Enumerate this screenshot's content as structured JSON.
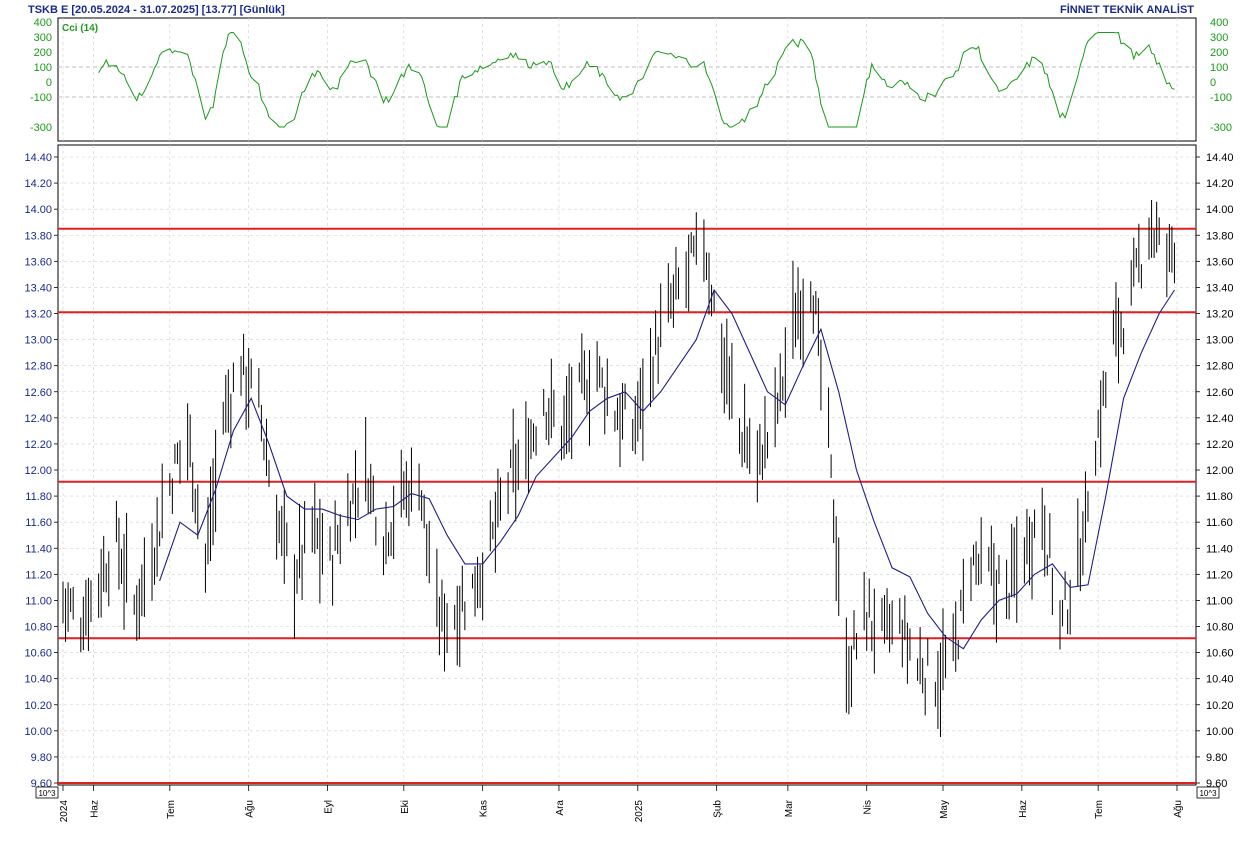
{
  "header": {
    "title": "TSKB  E  [20.05.2024 - 31.07.2025]  [13.77]  [Günlük]",
    "brand": "FİNNET TEKNİK ANALİST"
  },
  "indicator": {
    "label": "Cci (14)",
    "ticks": [
      "400",
      "300",
      "200",
      "100",
      "0",
      "-100",
      "-300"
    ],
    "tick_values": [
      400,
      300,
      200,
      100,
      0,
      -100,
      -300
    ],
    "ylim": [
      -380,
      400
    ],
    "color": "#1a9a1a"
  },
  "price_axis": {
    "ticks": [
      "14.40",
      "14.20",
      "14.00",
      "13.80",
      "13.60",
      "13.40",
      "13.20",
      "13.00",
      "12.80",
      "12.60",
      "12.40",
      "12.20",
      "12.00",
      "11.80",
      "11.60",
      "11.40",
      "11.20",
      "11.00",
      "10.80",
      "10.60",
      "10.40",
      "10.20",
      "10.00",
      "9.80",
      "9.60"
    ],
    "unit_label": "10^3",
    "ylim": [
      9.6,
      14.4
    ]
  },
  "time_axis": {
    "labels": [
      "2024",
      "Haz",
      "Tem",
      "Ağu",
      "Eyl",
      "Eki",
      "Kas",
      "Ara",
      "2025",
      "Şub",
      "Mar",
      "Nis",
      "May",
      "Haz",
      "Tem",
      "Ağu"
    ]
  },
  "levels": {
    "values": [
      13.85,
      13.21,
      11.91,
      10.71,
      9.6
    ],
    "color": "#e02020"
  },
  "chart_data": {
    "type": "bar",
    "title": "TSKB  E  [20.05.2024 - 31.07.2025]  [13.77]  [Günlük]",
    "xlabel": "",
    "ylabel": "",
    "ylim": [
      9.6,
      14.4
    ],
    "x_range": [
      "2024-05-20",
      "2025-07-31"
    ],
    "month_ticks": [
      {
        "label": "2024",
        "date": "2024-05-20"
      },
      {
        "label": "Haz",
        "date": "2024-06-01"
      },
      {
        "label": "Tem",
        "date": "2024-07-01"
      },
      {
        "label": "Ağu",
        "date": "2024-08-01"
      },
      {
        "label": "Eyl",
        "date": "2024-09-01"
      },
      {
        "label": "Eki",
        "date": "2024-10-01"
      },
      {
        "label": "Kas",
        "date": "2024-11-01"
      },
      {
        "label": "Ara",
        "date": "2024-12-01"
      },
      {
        "label": "2025",
        "date": "2025-01-01"
      },
      {
        "label": "Şub",
        "date": "2025-02-01"
      },
      {
        "label": "Mar",
        "date": "2025-03-01"
      },
      {
        "label": "Nis",
        "date": "2025-04-01"
      },
      {
        "label": "May",
        "date": "2025-05-01"
      },
      {
        "label": "Haz",
        "date": "2025-06-01"
      },
      {
        "label": "Tem",
        "date": "2025-07-01"
      },
      {
        "label": "Ağu",
        "date": "2025-08-01"
      }
    ],
    "last_close": 13.77,
    "series": [
      {
        "kind": "close",
        "points": [
          [
            "2024-05-20",
            11.0
          ],
          [
            "2024-05-27",
            10.85
          ],
          [
            "2024-06-03",
            11.15
          ],
          [
            "2024-06-10",
            11.45
          ],
          [
            "2024-06-17",
            10.95
          ],
          [
            "2024-06-24",
            11.35
          ],
          [
            "2024-07-01",
            11.9
          ],
          [
            "2024-07-08",
            12.3
          ],
          [
            "2024-07-15",
            11.3
          ],
          [
            "2024-07-22",
            12.4
          ],
          [
            "2024-07-29",
            12.8
          ],
          [
            "2024-08-05",
            12.5
          ],
          [
            "2024-08-12",
            11.6
          ],
          [
            "2024-08-19",
            11.2
          ],
          [
            "2024-08-26",
            11.55
          ],
          [
            "2024-09-02",
            11.3
          ],
          [
            "2024-09-09",
            11.7
          ],
          [
            "2024-09-16",
            12.0
          ],
          [
            "2024-09-23",
            11.5
          ],
          [
            "2024-09-30",
            11.8
          ],
          [
            "2024-10-07",
            11.95
          ],
          [
            "2024-10-14",
            10.85
          ],
          [
            "2024-10-21",
            10.9
          ],
          [
            "2024-10-28",
            11.1
          ],
          [
            "2024-11-04",
            11.4
          ],
          [
            "2024-11-11",
            11.9
          ],
          [
            "2024-11-18",
            12.1
          ],
          [
            "2024-11-25",
            12.55
          ],
          [
            "2024-12-02",
            12.3
          ],
          [
            "2024-12-09",
            12.6
          ],
          [
            "2024-12-16",
            12.75
          ],
          [
            "2024-12-23",
            12.45
          ],
          [
            "2024-12-30",
            12.3
          ],
          [
            "2025-01-06",
            12.8
          ],
          [
            "2025-01-13",
            13.2
          ],
          [
            "2025-01-20",
            13.5
          ],
          [
            "2025-01-27",
            13.75
          ],
          [
            "2025-02-03",
            12.9
          ],
          [
            "2025-02-10",
            12.3
          ],
          [
            "2025-02-17",
            12.05
          ],
          [
            "2025-02-24",
            12.4
          ],
          [
            "2025-03-03",
            13.1
          ],
          [
            "2025-03-10",
            13.5
          ],
          [
            "2025-03-17",
            12.2
          ],
          [
            "2025-03-24",
            10.4
          ],
          [
            "2025-03-31",
            10.9
          ],
          [
            "2025-04-07",
            10.75
          ],
          [
            "2025-04-14",
            10.8
          ],
          [
            "2025-04-21",
            10.5
          ],
          [
            "2025-04-28",
            10.4
          ],
          [
            "2025-05-05",
            10.55
          ],
          [
            "2025-05-12",
            11.3
          ],
          [
            "2025-05-19",
            11.2
          ],
          [
            "2025-05-26",
            11.05
          ],
          [
            "2025-06-02",
            11.4
          ],
          [
            "2025-06-09",
            11.7
          ],
          [
            "2025-06-16",
            10.8
          ],
          [
            "2025-06-23",
            11.25
          ],
          [
            "2025-06-30",
            12.2
          ],
          [
            "2025-07-07",
            13.0
          ],
          [
            "2025-07-14",
            13.3
          ],
          [
            "2025-07-21",
            13.9
          ],
          [
            "2025-07-28",
            13.6
          ],
          [
            "2025-07-31",
            13.77
          ]
        ]
      },
      {
        "kind": "moving-average",
        "color": "#1f1f8a",
        "points": [
          [
            "2024-06-27",
            11.15
          ],
          [
            "2024-07-05",
            11.6
          ],
          [
            "2024-07-12",
            11.5
          ],
          [
            "2024-07-19",
            11.85
          ],
          [
            "2024-07-26",
            12.3
          ],
          [
            "2024-08-02",
            12.55
          ],
          [
            "2024-08-09",
            12.2
          ],
          [
            "2024-08-16",
            11.8
          ],
          [
            "2024-08-23",
            11.7
          ],
          [
            "2024-08-30",
            11.7
          ],
          [
            "2024-09-06",
            11.65
          ],
          [
            "2024-09-13",
            11.62
          ],
          [
            "2024-09-20",
            11.7
          ],
          [
            "2024-09-27",
            11.72
          ],
          [
            "2024-10-04",
            11.82
          ],
          [
            "2024-10-11",
            11.78
          ],
          [
            "2024-10-18",
            11.5
          ],
          [
            "2024-10-25",
            11.28
          ],
          [
            "2024-11-01",
            11.28
          ],
          [
            "2024-11-08",
            11.45
          ],
          [
            "2024-11-15",
            11.65
          ],
          [
            "2024-11-22",
            11.95
          ],
          [
            "2024-11-29",
            12.1
          ],
          [
            "2024-12-06",
            12.25
          ],
          [
            "2024-12-13",
            12.45
          ],
          [
            "2024-12-20",
            12.55
          ],
          [
            "2024-12-27",
            12.6
          ],
          [
            "2025-01-03",
            12.45
          ],
          [
            "2025-01-10",
            12.6
          ],
          [
            "2025-01-17",
            12.8
          ],
          [
            "2025-01-24",
            13.0
          ],
          [
            "2025-01-31",
            13.38
          ],
          [
            "2025-02-07",
            13.2
          ],
          [
            "2025-02-14",
            12.9
          ],
          [
            "2025-02-21",
            12.6
          ],
          [
            "2025-02-28",
            12.5
          ],
          [
            "2025-03-07",
            12.8
          ],
          [
            "2025-03-14",
            13.08
          ],
          [
            "2025-03-21",
            12.6
          ],
          [
            "2025-03-28",
            12.0
          ],
          [
            "2025-04-04",
            11.6
          ],
          [
            "2025-04-11",
            11.25
          ],
          [
            "2025-04-18",
            11.18
          ],
          [
            "2025-04-25",
            10.9
          ],
          [
            "2025-05-02",
            10.72
          ],
          [
            "2025-05-09",
            10.63
          ],
          [
            "2025-05-16",
            10.85
          ],
          [
            "2025-05-23",
            11.0
          ],
          [
            "2025-05-30",
            11.05
          ],
          [
            "2025-06-06",
            11.2
          ],
          [
            "2025-06-13",
            11.28
          ],
          [
            "2025-06-20",
            11.1
          ],
          [
            "2025-06-27",
            11.12
          ],
          [
            "2025-07-04",
            11.8
          ],
          [
            "2025-07-11",
            12.55
          ],
          [
            "2025-07-18",
            12.9
          ],
          [
            "2025-07-25",
            13.2
          ],
          [
            "2025-07-31",
            13.38
          ]
        ]
      }
    ]
  }
}
